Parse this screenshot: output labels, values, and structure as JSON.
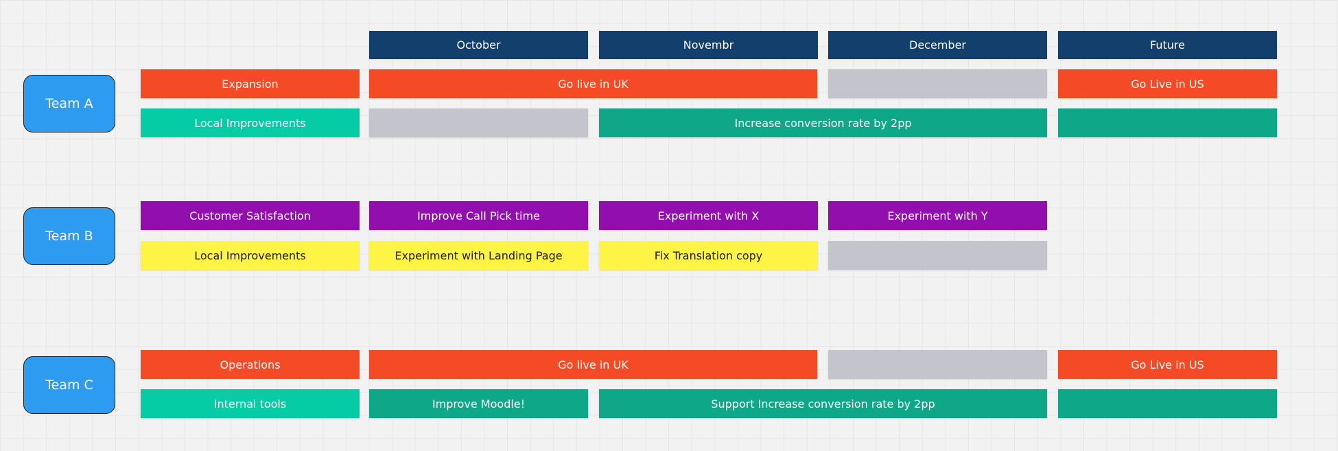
{
  "colors": {
    "header": "#123f6b",
    "orange": "#f44a26",
    "teal": "#06cca5",
    "darkteal": "#0ea788",
    "grey": "#c3c4cc",
    "purple": "#920fae",
    "yellow": "#fef445",
    "team": "#2d9bf0"
  },
  "headers": [
    {
      "col": 1,
      "label": "October"
    },
    {
      "col": 2,
      "label": "Novembr"
    },
    {
      "col": 3,
      "label": "December"
    },
    {
      "col": 4,
      "label": "Future"
    }
  ],
  "teams": [
    {
      "name": "Team A",
      "rows": [
        [
          {
            "col": 0,
            "span": 1,
            "color": "orange",
            "label": "Expansion"
          },
          {
            "col": 1,
            "span": 2,
            "color": "orange",
            "label": "Go live in UK"
          },
          {
            "col": 3,
            "span": 1,
            "color": "grey",
            "label": ""
          },
          {
            "col": 4,
            "span": 1,
            "color": "orange",
            "label": "Go Live in US"
          }
        ],
        [
          {
            "col": 0,
            "span": 1,
            "color": "teal",
            "label": "Local Improvements"
          },
          {
            "col": 1,
            "span": 1,
            "color": "grey",
            "label": ""
          },
          {
            "col": 2,
            "span": 2,
            "color": "darkteal",
            "label": "Increase conversion rate by 2pp"
          },
          {
            "col": 4,
            "span": 1,
            "color": "darkteal",
            "label": ""
          }
        ]
      ]
    },
    {
      "name": "Team B",
      "rows": [
        [
          {
            "col": 0,
            "span": 1,
            "color": "purple",
            "label": "Customer Satisfaction"
          },
          {
            "col": 1,
            "span": 1,
            "color": "purple",
            "label": "Improve Call Pick time"
          },
          {
            "col": 2,
            "span": 1,
            "color": "purple",
            "label": "Experiment with X"
          },
          {
            "col": 3,
            "span": 1,
            "color": "purple",
            "label": "Experiment with Y"
          }
        ],
        [
          {
            "col": 0,
            "span": 1,
            "color": "yellow",
            "label": "Local Improvements"
          },
          {
            "col": 1,
            "span": 1,
            "color": "yellow",
            "label": "Experiment with Landing Page"
          },
          {
            "col": 2,
            "span": 1,
            "color": "yellow",
            "label": "Fix Translation copy"
          },
          {
            "col": 3,
            "span": 1,
            "color": "grey",
            "label": ""
          }
        ]
      ]
    },
    {
      "name": "Team C",
      "rows": [
        [
          {
            "col": 0,
            "span": 1,
            "color": "orange",
            "label": "Operations"
          },
          {
            "col": 1,
            "span": 2,
            "color": "orange",
            "label": "Go live in UK"
          },
          {
            "col": 3,
            "span": 1,
            "color": "grey",
            "label": ""
          },
          {
            "col": 4,
            "span": 1,
            "color": "orange",
            "label": "Go Live in US"
          }
        ],
        [
          {
            "col": 0,
            "span": 1,
            "color": "teal",
            "label": "Internal tools"
          },
          {
            "col": 1,
            "span": 1,
            "color": "darkteal",
            "label": "Improve Moodle!"
          },
          {
            "col": 2,
            "span": 2,
            "color": "darkteal",
            "label": "Support Increase conversion rate by 2pp"
          },
          {
            "col": 4,
            "span": 1,
            "color": "darkteal",
            "label": ""
          }
        ]
      ]
    }
  ]
}
